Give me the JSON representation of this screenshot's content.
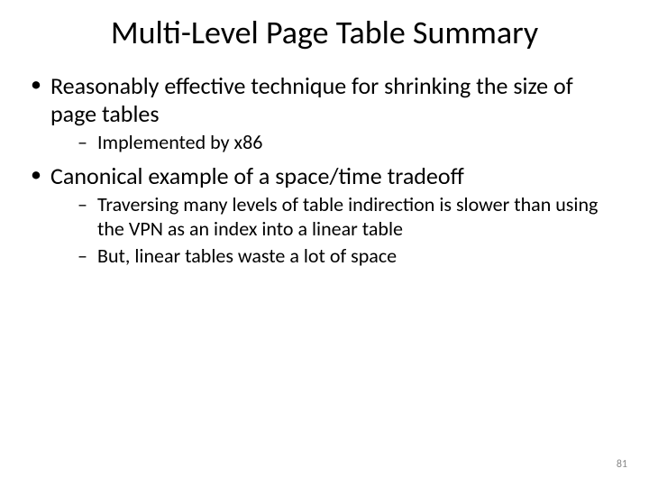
{
  "title": "Multi-Level Page Table Summary",
  "bullets": [
    {
      "text": "Reasonably effective technique for shrinking the size of page tables",
      "sub": [
        "Implemented by x86"
      ]
    },
    {
      "text": "Canonical example of a space/time tradeoff",
      "sub": [
        "Traversing many levels of table indirection is slower than using the VPN as an index into a linear table",
        "But, linear tables waste a lot of space"
      ]
    }
  ],
  "page_number": "81"
}
